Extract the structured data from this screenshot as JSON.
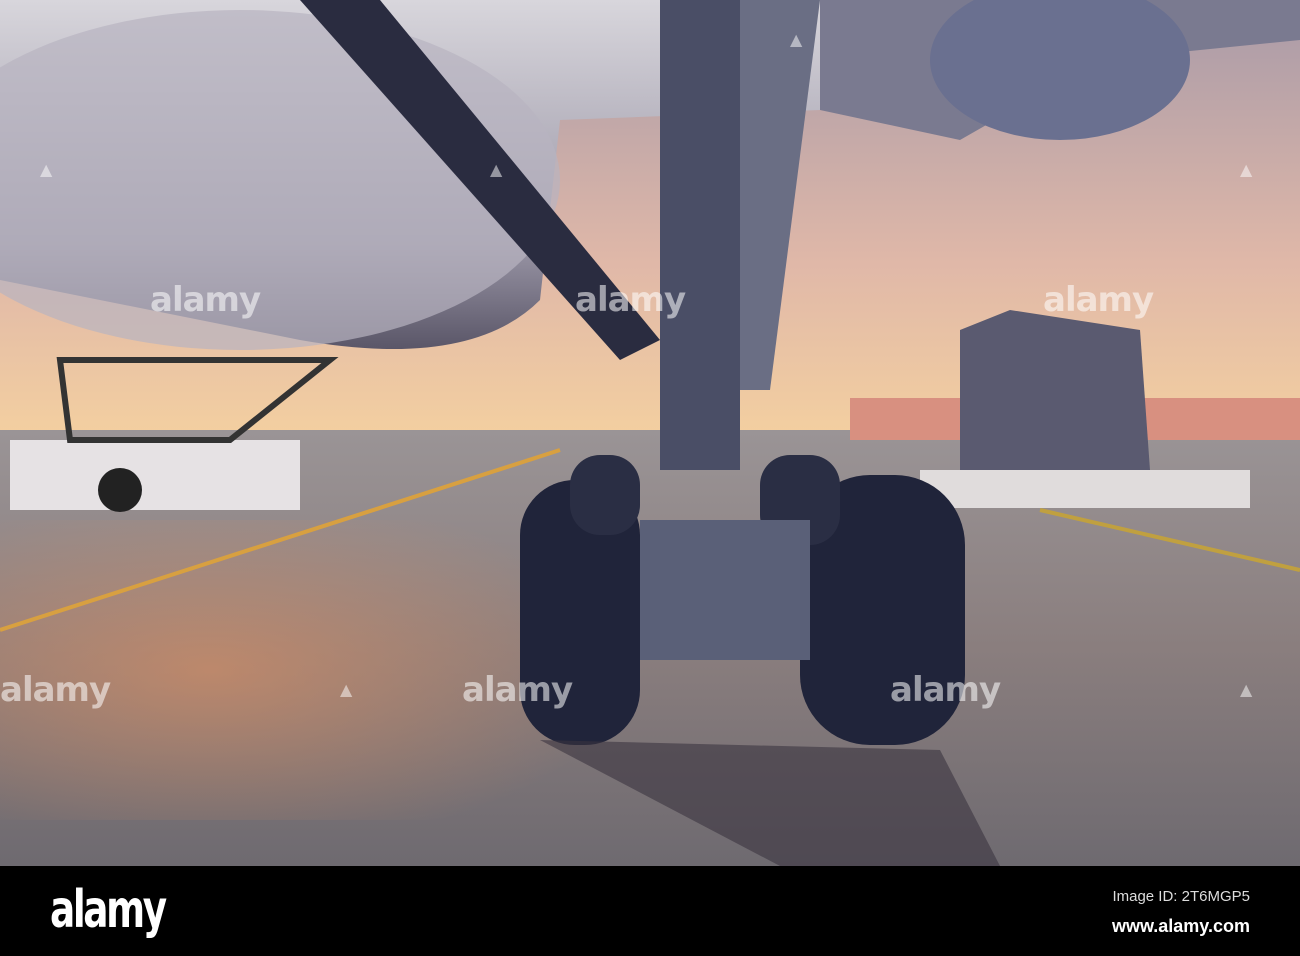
{
  "watermark": {
    "text": "alamy",
    "icon": "alamy-a-icon"
  },
  "footer": {
    "logo": "alamy",
    "image_id": "Image ID: 2T6MGP5",
    "website": "www.alamy.com"
  },
  "colors": {
    "sky_top": "#b9a6b4",
    "sky_horizon": "#f2c89a",
    "tarmac": "#8f8a8c",
    "footer": "#000000"
  }
}
